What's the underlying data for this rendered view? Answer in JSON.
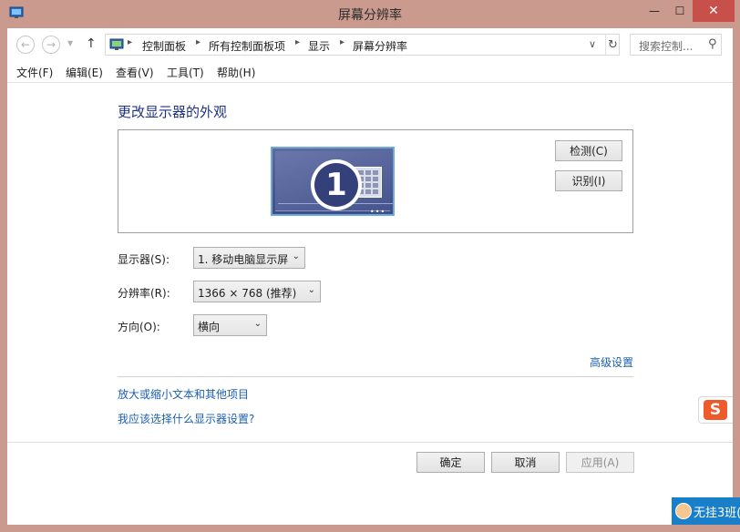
{
  "window": {
    "title": "屏幕分辨率",
    "minimize_glyph": "—",
    "maximize_glyph": "☐",
    "close_glyph": "✕"
  },
  "address": {
    "back_glyph": "←",
    "forward_glyph": "→",
    "recent_glyph": "▼",
    "up_glyph": "↑",
    "breadcrumbs": [
      "控制面板",
      "所有控制面板项",
      "显示",
      "屏幕分辨率"
    ],
    "separator": "▸",
    "dropdown_glyph": "∨",
    "refresh_glyph": "↻",
    "search_placeholder": "搜索控制...",
    "search_glyph": "⚲"
  },
  "menu": {
    "items": [
      "文件(F)",
      "编辑(E)",
      "查看(V)",
      "工具(T)",
      "帮助(H)"
    ]
  },
  "main": {
    "heading": "更改显示器的外观",
    "monitor_number": "1",
    "monitor_dots": "•••",
    "detect_label": "检测(C)",
    "identify_label": "识别(I)",
    "display_label": "显示器(S):",
    "display_value": "1. 移动电脑显示屏",
    "resolution_label": "分辨率(R):",
    "resolution_value": "1366 × 768 (推荐)",
    "orientation_label": "方向(O):",
    "orientation_value": "横向",
    "select_arrow": "⌄",
    "advanced_link": "高级设置",
    "text_size_link": "放大或缩小文本和其他项目",
    "which_setting_link": "我应该选择什么显示器设置?"
  },
  "footer": {
    "ok_label": "确定",
    "cancel_label": "取消",
    "apply_label": "应用(A)"
  },
  "overlays": {
    "ime_badge": "S",
    "notification_text": "无挂3班(",
    "accent_color": "#1a7fc9"
  },
  "icons": {
    "window_icon": "display-panel-icon",
    "address_icon": "control-panel-icon"
  }
}
